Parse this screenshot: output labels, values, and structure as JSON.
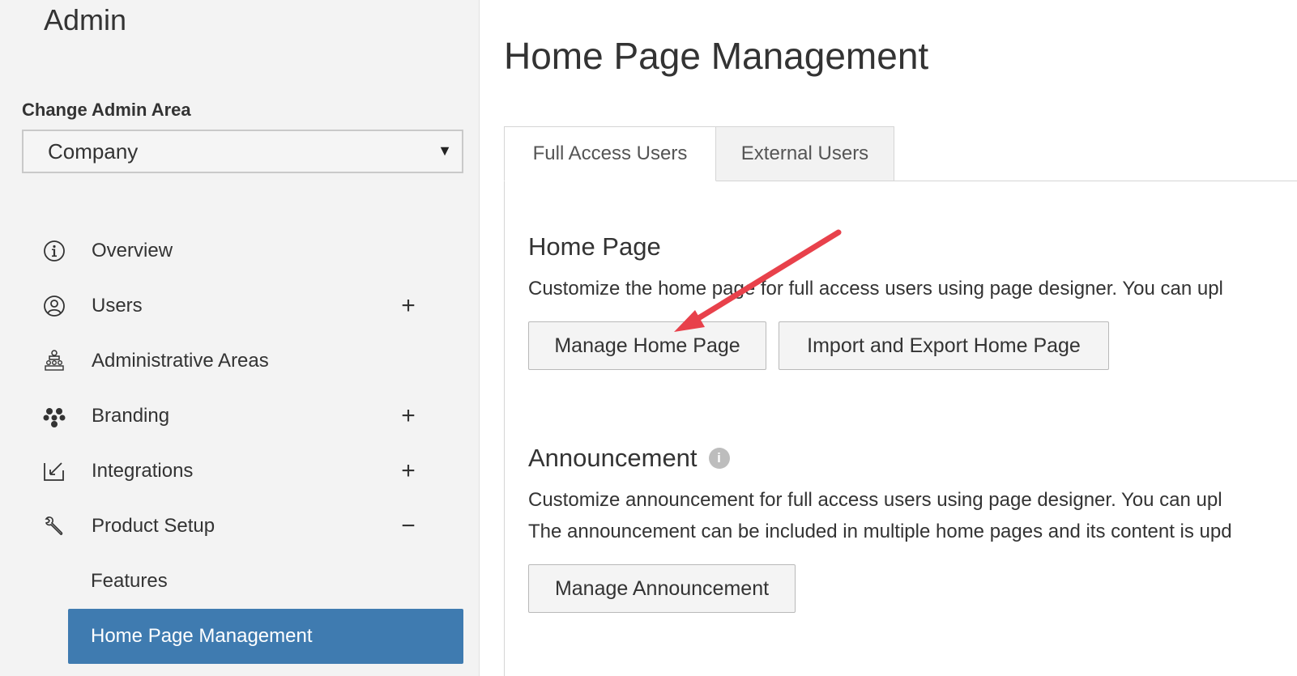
{
  "sidebar": {
    "title": "Admin",
    "area_label": "Change Admin Area",
    "area_selected": "Company",
    "items": [
      {
        "label": "Overview",
        "icon": "info-circle-icon",
        "toggle": ""
      },
      {
        "label": "Users",
        "icon": "user-circle-icon",
        "toggle": "+"
      },
      {
        "label": "Administrative Areas",
        "icon": "org-hierarchy-icon",
        "toggle": ""
      },
      {
        "label": "Branding",
        "icon": "branding-dots-icon",
        "toggle": "+"
      },
      {
        "label": "Integrations",
        "icon": "integration-arrow-icon",
        "toggle": "+"
      },
      {
        "label": "Product Setup",
        "icon": "wrench-icon",
        "toggle": "−"
      }
    ],
    "sub_items": [
      {
        "label": "Features"
      },
      {
        "label": "Home Page Management"
      }
    ]
  },
  "main": {
    "title": "Home Page Management",
    "tabs": [
      {
        "label": "Full Access Users"
      },
      {
        "label": "External Users"
      }
    ],
    "home_page": {
      "title": "Home Page",
      "desc": "Customize the home page for full access users using page designer. You can upl",
      "buttons": [
        "Manage Home Page",
        "Import and Export Home Page"
      ]
    },
    "announcement": {
      "title": "Announcement",
      "desc_lines": [
        "Customize announcement for full access users using page designer. You can upl",
        "The announcement can be included in multiple home pages and its content is upd"
      ],
      "button": "Manage Announcement"
    }
  },
  "colors": {
    "active_nav": "#3f7bb0",
    "annotation_arrow": "#e8414b"
  }
}
